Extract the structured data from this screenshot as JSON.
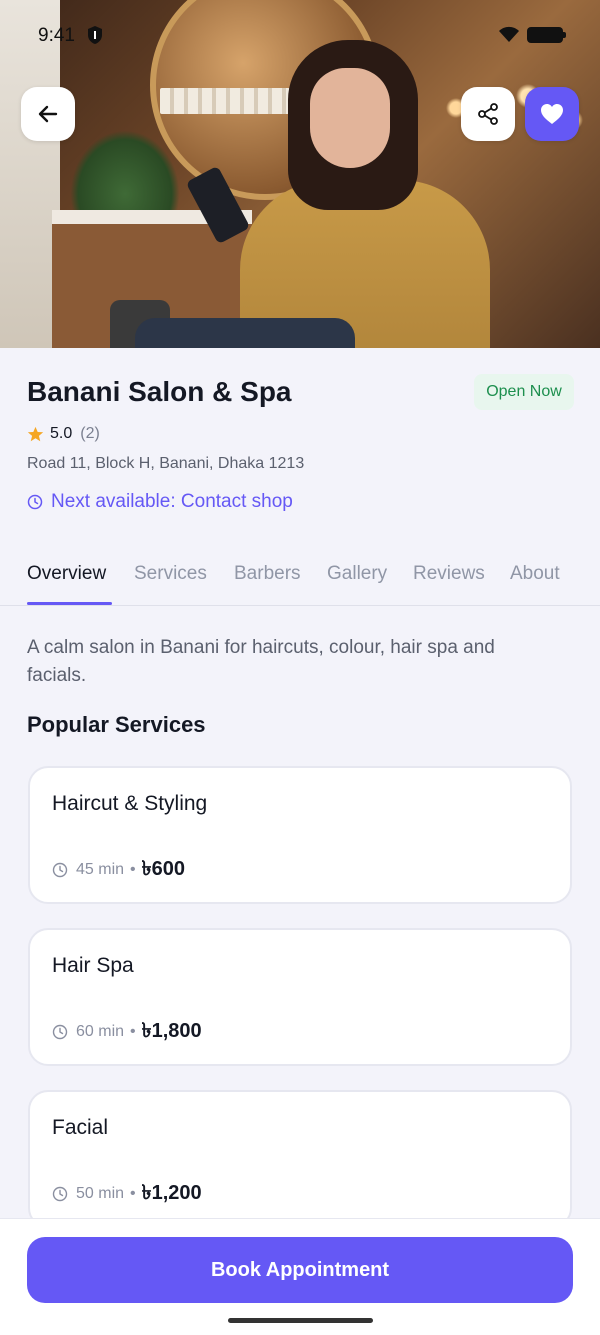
{
  "status_bar": {
    "time": "9:41"
  },
  "hero": {
    "back_icon": "arrow-left-icon",
    "share_icon": "share-icon",
    "favorite_icon": "heart-icon"
  },
  "salon": {
    "name": "Banani Salon & Spa",
    "status": "Open Now",
    "rating": "5.0",
    "review_count": "(2)",
    "address": "Road 11, Block H, Banani, Dhaka 1213",
    "next_available": "Next available: Contact shop"
  },
  "tabs": [
    {
      "label": "Overview",
      "active": true
    },
    {
      "label": "Services"
    },
    {
      "label": "Barbers"
    },
    {
      "label": "Gallery"
    },
    {
      "label": "Reviews"
    },
    {
      "label": "About"
    }
  ],
  "overview": {
    "description": "A calm salon in Banani for haircuts, colour, hair spa and facials.",
    "popular_title": "Popular Services"
  },
  "services": [
    {
      "name": "Haircut & Styling",
      "duration": "45 min",
      "separator": "•",
      "price": "৳600"
    },
    {
      "name": "Hair Spa",
      "duration": "60 min",
      "separator": "•",
      "price": "৳1,800"
    },
    {
      "name": "Facial",
      "duration": "50 min",
      "separator": "•",
      "price": "৳1,200"
    }
  ],
  "cta": {
    "book_label": "Book Appointment"
  },
  "colors": {
    "accent": "#6558f5",
    "open_badge_bg": "#e8f6ee",
    "open_badge_text": "#1d8f4e",
    "star": "#f5a623"
  }
}
